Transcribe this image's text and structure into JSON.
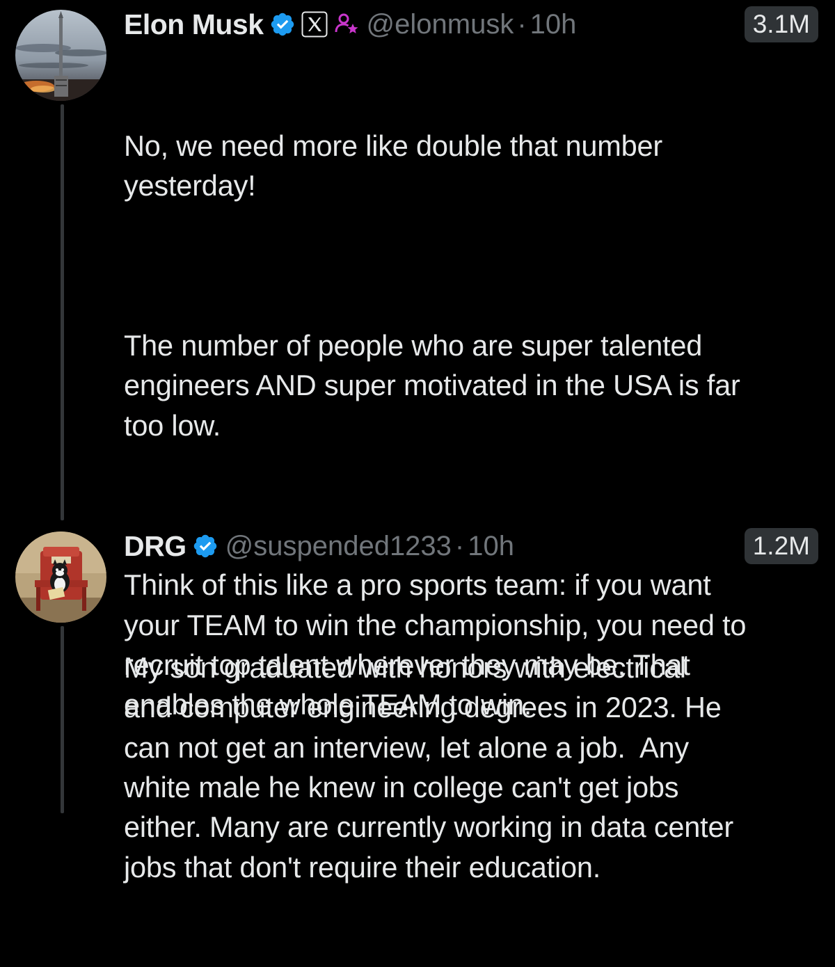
{
  "thread": {
    "tweets": [
      {
        "author": {
          "display_name": "Elon Musk",
          "handle": "@elonmusk",
          "avatar_icon": "starship-launch-avatar",
          "badges": [
            "verified-badge-icon",
            "x-affiliate-badge-icon",
            "user-star-icon"
          ]
        },
        "separator": "·",
        "time": "10h",
        "views": "3.1M",
        "paragraphs": [
          "No, we need more like double that number\nyesterday!",
          "The number of people who are super talented\nengineers AND super motivated in the USA is far\ntoo low.",
          "Think of this like a pro sports team: if you want\nyour TEAM to win the championship, you need to\nrecruit top talent wherever they may be. That\nenables the whole TEAM to win."
        ]
      },
      {
        "author": {
          "display_name": "DRG",
          "handle": "@suspended1233",
          "avatar_icon": "cartoon-cat-avatar",
          "badges": [
            "verified-badge-icon"
          ]
        },
        "separator": "·",
        "time": "10h",
        "views": "1.2M",
        "paragraphs": [
          "My son graduated with honors with electrical\nand computer engineering degrees in 2023. He\ncan not get an interview, let alone a job.  Any\nwhite male he knew in college can't get jobs\neither. Many are currently working in data center\njobs that don't require their education."
        ]
      }
    ]
  },
  "colors": {
    "background": "#000000",
    "primary_text": "#e7e9ea",
    "secondary_text": "#71767b",
    "verified_blue": "#1d9bf0",
    "thread_line": "#333639",
    "views_pill": "#2f3336",
    "affiliate_icon": "#c936cc"
  }
}
